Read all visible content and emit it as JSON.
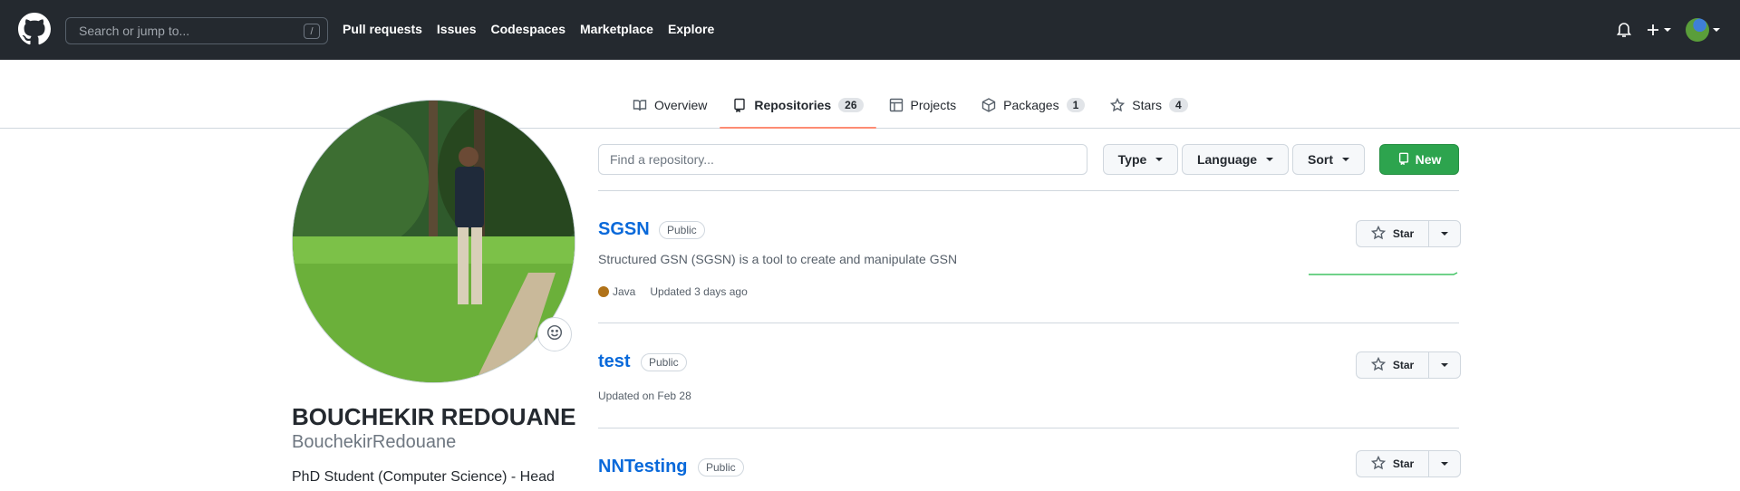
{
  "header": {
    "search_placeholder": "Search or jump to...",
    "search_shortcut": "/",
    "nav": [
      "Pull requests",
      "Issues",
      "Codespaces",
      "Marketplace",
      "Explore"
    ]
  },
  "tabs": [
    {
      "label": "Overview",
      "icon": "book-icon",
      "count": null,
      "selected": false
    },
    {
      "label": "Repositories",
      "icon": "repo-icon",
      "count": "26",
      "selected": true
    },
    {
      "label": "Projects",
      "icon": "table-icon",
      "count": null,
      "selected": false
    },
    {
      "label": "Packages",
      "icon": "package-icon",
      "count": "1",
      "selected": false
    },
    {
      "label": "Stars",
      "icon": "star-icon",
      "count": "4",
      "selected": false
    }
  ],
  "profile": {
    "fullname": "BOUCHEKIR REDOUANE",
    "username": "BouchekirRedouane",
    "bio": "PhD Student (Computer Science) - Head"
  },
  "filters": {
    "find_placeholder": "Find a repository...",
    "type_label": "Type",
    "language_label": "Language",
    "sort_label": "Sort",
    "new_label": "New"
  },
  "repos": [
    {
      "name": "SGSN",
      "visibility": "Public",
      "description": "Structured GSN (SGSN) is a tool to create and manipulate GSN",
      "language": "Java",
      "updated": "Updated 3 days ago",
      "star_label": "Star"
    },
    {
      "name": "test",
      "visibility": "Public",
      "description": "",
      "language": "",
      "updated": "Updated on Feb 28",
      "star_label": "Star"
    },
    {
      "name": "NNTesting",
      "visibility": "Public",
      "description": "",
      "language": "",
      "updated": "",
      "star_label": "Star"
    }
  ],
  "colors": {
    "header_bg": "#24292f",
    "accent_link": "#0969da",
    "new_button": "#2da44e",
    "tab_underline": "#fd8c73",
    "java_color": "#b07219"
  }
}
